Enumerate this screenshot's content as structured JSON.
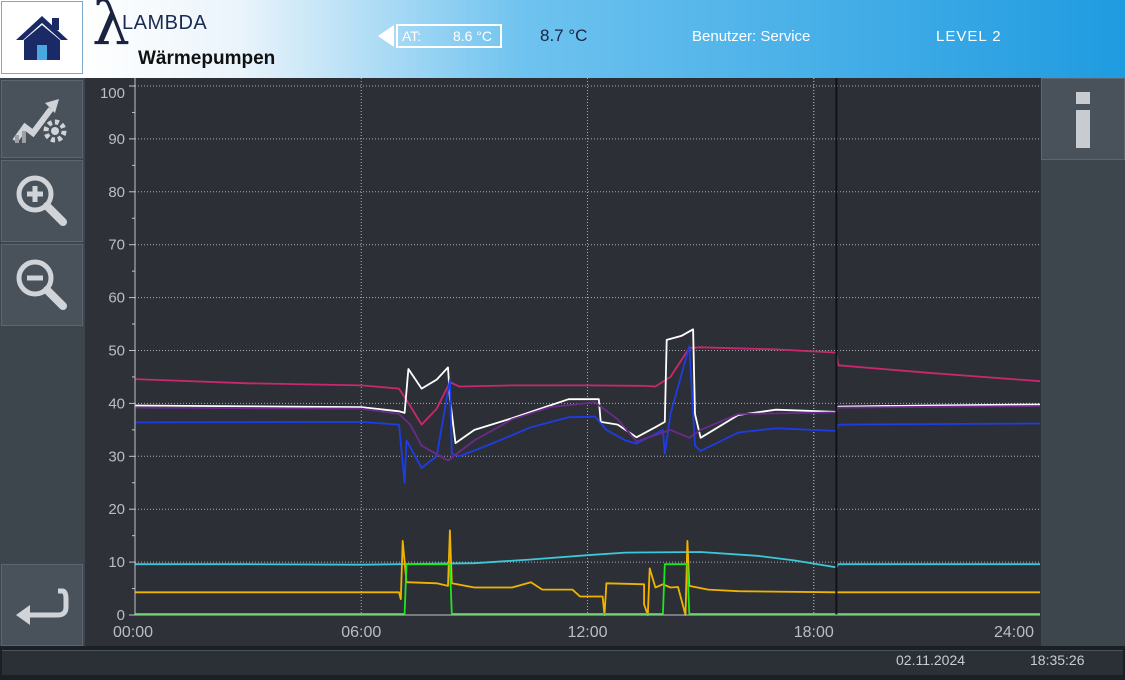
{
  "header": {
    "logo_symbol": "λ",
    "brand_line1": "LAMBDA",
    "brand_line2": "Wärmepumpen",
    "at_label": "AT:",
    "at_value": "8.6 °C",
    "second_temp": "8.7 °C",
    "user_text": "Benutzer:  Service",
    "level_text": "LEVEL   2"
  },
  "icons": {
    "home": "home-icon",
    "chart_settings": "chart-settings-icon",
    "zoom_in": "zoom-in-icon",
    "zoom_out": "zoom-out-icon",
    "back": "back-arrow-icon",
    "info": "info-icon"
  },
  "colors": {
    "header_dark": "#1a2440",
    "accent_blue": "#1f9be0",
    "series_pink": "#c8286e",
    "series_white": "#ffffff",
    "series_blue": "#1e3ce6",
    "series_purple": "#6a2a8a",
    "series_cyan": "#3cc8d8",
    "series_orange": "#f0b400",
    "series_green": "#1ee61e"
  },
  "chart_data": {
    "type": "line",
    "x_ticks": [
      "00:00",
      "06:00",
      "12:00",
      "18:00",
      "24:00"
    ],
    "y_ticks": [
      "0",
      "10",
      "20",
      "30",
      "40",
      "50",
      "60",
      "70",
      "80",
      "90",
      "100"
    ],
    "xlim": [
      0,
      24
    ],
    "ylim": [
      0,
      100
    ],
    "grid": true,
    "cursor_time": 18.6,
    "series": [
      {
        "color": "#c8286e",
        "points": [
          [
            0,
            44.6
          ],
          [
            3,
            43.8
          ],
          [
            6,
            43.4
          ],
          [
            7.0,
            42.8
          ],
          [
            7.3,
            39.5
          ],
          [
            7.6,
            36
          ],
          [
            8.0,
            39
          ],
          [
            8.35,
            44
          ],
          [
            8.6,
            43.2
          ],
          [
            10,
            43.4
          ],
          [
            12,
            43.4
          ],
          [
            13.5,
            43.3
          ],
          [
            13.8,
            43.2
          ],
          [
            14.2,
            45
          ],
          [
            14.7,
            50.5
          ],
          [
            15,
            50.6
          ],
          [
            17,
            50.2
          ],
          [
            18.6,
            49.6
          ],
          [
            18.65,
            47.2
          ],
          [
            21,
            45.8
          ],
          [
            24,
            44.2
          ]
        ]
      },
      {
        "color": "#ffffff",
        "points": [
          [
            0,
            39.6
          ],
          [
            6,
            39.3
          ],
          [
            7.0,
            38.5
          ],
          [
            7.15,
            38.2
          ],
          [
            7.25,
            46.5
          ],
          [
            7.6,
            42.8
          ],
          [
            8.0,
            44.5
          ],
          [
            8.3,
            46.8
          ],
          [
            8.35,
            41
          ],
          [
            8.5,
            32.5
          ],
          [
            9,
            35
          ],
          [
            10,
            37.2
          ],
          [
            11,
            39.6
          ],
          [
            11.5,
            40.8
          ],
          [
            12.3,
            40.8
          ],
          [
            12.35,
            36.5
          ],
          [
            12.8,
            36
          ],
          [
            13.3,
            33.6
          ],
          [
            13.8,
            35.5
          ],
          [
            14.05,
            36.5
          ],
          [
            14.1,
            52
          ],
          [
            14.5,
            52.8
          ],
          [
            14.8,
            54
          ],
          [
            14.85,
            38
          ],
          [
            15.0,
            33.5
          ],
          [
            16,
            37.8
          ],
          [
            17,
            38.8
          ],
          [
            18.6,
            38.4
          ],
          [
            18.65,
            39.4
          ],
          [
            21,
            39.6
          ],
          [
            24,
            39.8
          ]
        ]
      },
      {
        "color": "#1e3ce6",
        "points": [
          [
            0,
            36.4
          ],
          [
            6,
            36.5
          ],
          [
            7.0,
            36
          ],
          [
            7.15,
            25
          ],
          [
            7.2,
            33
          ],
          [
            7.6,
            27.8
          ],
          [
            8.0,
            30
          ],
          [
            8.35,
            44.5
          ],
          [
            8.4,
            30.5
          ],
          [
            8.6,
            30
          ],
          [
            9.5,
            32.5
          ],
          [
            10.5,
            35.5
          ],
          [
            11.5,
            37.4
          ],
          [
            12.2,
            37.5
          ],
          [
            12.5,
            35
          ],
          [
            13,
            33
          ],
          [
            13.3,
            32.4
          ],
          [
            14.0,
            35
          ],
          [
            14.05,
            30.5
          ],
          [
            14.2,
            38
          ],
          [
            14.7,
            50.8
          ],
          [
            14.85,
            32
          ],
          [
            15,
            31
          ],
          [
            16,
            34.5
          ],
          [
            17,
            35.3
          ],
          [
            18.6,
            34.8
          ],
          [
            18.65,
            36
          ],
          [
            24,
            36.2
          ]
        ]
      },
      {
        "color": "#6a2a8a",
        "points": [
          [
            0,
            39.2
          ],
          [
            6,
            39
          ],
          [
            7.0,
            38
          ],
          [
            7.3,
            36
          ],
          [
            7.6,
            32
          ],
          [
            8.3,
            29.2
          ],
          [
            9,
            33
          ],
          [
            10,
            37
          ],
          [
            11,
            39.3
          ],
          [
            12.2,
            40.2
          ],
          [
            12.8,
            37
          ],
          [
            13.3,
            32.8
          ],
          [
            14.2,
            35
          ],
          [
            14.7,
            33.5
          ],
          [
            15,
            35
          ],
          [
            16,
            38
          ],
          [
            18.6,
            38.3
          ],
          [
            18.65,
            39.2
          ],
          [
            24,
            39.5
          ]
        ]
      },
      {
        "color": "#3cc8d8",
        "points": [
          [
            0,
            9.6
          ],
          [
            3,
            9.6
          ],
          [
            6,
            9.5
          ],
          [
            7,
            9.6
          ],
          [
            9,
            9.8
          ],
          [
            10.5,
            10.5
          ],
          [
            12,
            11.3
          ],
          [
            13,
            11.8
          ],
          [
            15,
            11.9
          ],
          [
            16.5,
            11.2
          ],
          [
            17.5,
            10.3
          ],
          [
            18.6,
            9
          ],
          [
            18.65,
            9.6
          ],
          [
            24,
            9.6
          ]
        ]
      },
      {
        "color": "#f0b400",
        "points": [
          [
            0,
            4.3
          ],
          [
            6,
            4.3
          ],
          [
            7.0,
            4.3
          ],
          [
            7.05,
            3
          ],
          [
            7.1,
            14
          ],
          [
            7.2,
            6.2
          ],
          [
            8,
            6.0
          ],
          [
            8.3,
            5.5
          ],
          [
            8.35,
            16
          ],
          [
            8.4,
            6
          ],
          [
            9,
            5.2
          ],
          [
            10,
            5.2
          ],
          [
            10.5,
            6.2
          ],
          [
            10.8,
            4.8
          ],
          [
            11.6,
            4.8
          ],
          [
            11.8,
            3.5
          ],
          [
            12.4,
            3.5
          ],
          [
            12.45,
            0
          ],
          [
            12.5,
            6
          ],
          [
            13.5,
            5.8
          ],
          [
            13.5,
            2
          ],
          [
            13.6,
            0
          ],
          [
            13.65,
            8.8
          ],
          [
            13.8,
            5.2
          ],
          [
            14.0,
            5.8
          ],
          [
            14.2,
            5.2
          ],
          [
            14.4,
            5.3
          ],
          [
            14.6,
            0
          ],
          [
            14.65,
            14
          ],
          [
            14.7,
            5.5
          ],
          [
            15.2,
            4.8
          ],
          [
            16,
            4.5
          ],
          [
            18.6,
            4.3
          ],
          [
            24,
            4.3
          ]
        ]
      },
      {
        "color": "#1ee61e",
        "points": [
          [
            0,
            0.2
          ],
          [
            7.15,
            0.2
          ],
          [
            7.2,
            9.6
          ],
          [
            8.35,
            9.6
          ],
          [
            8.4,
            0.2
          ],
          [
            14.0,
            0.2
          ],
          [
            14.05,
            9.6
          ],
          [
            14.65,
            9.6
          ],
          [
            14.7,
            0.2
          ],
          [
            24,
            0.2
          ]
        ]
      }
    ]
  },
  "footer": {
    "date": "02.11.2024",
    "time": "18:35:26"
  }
}
